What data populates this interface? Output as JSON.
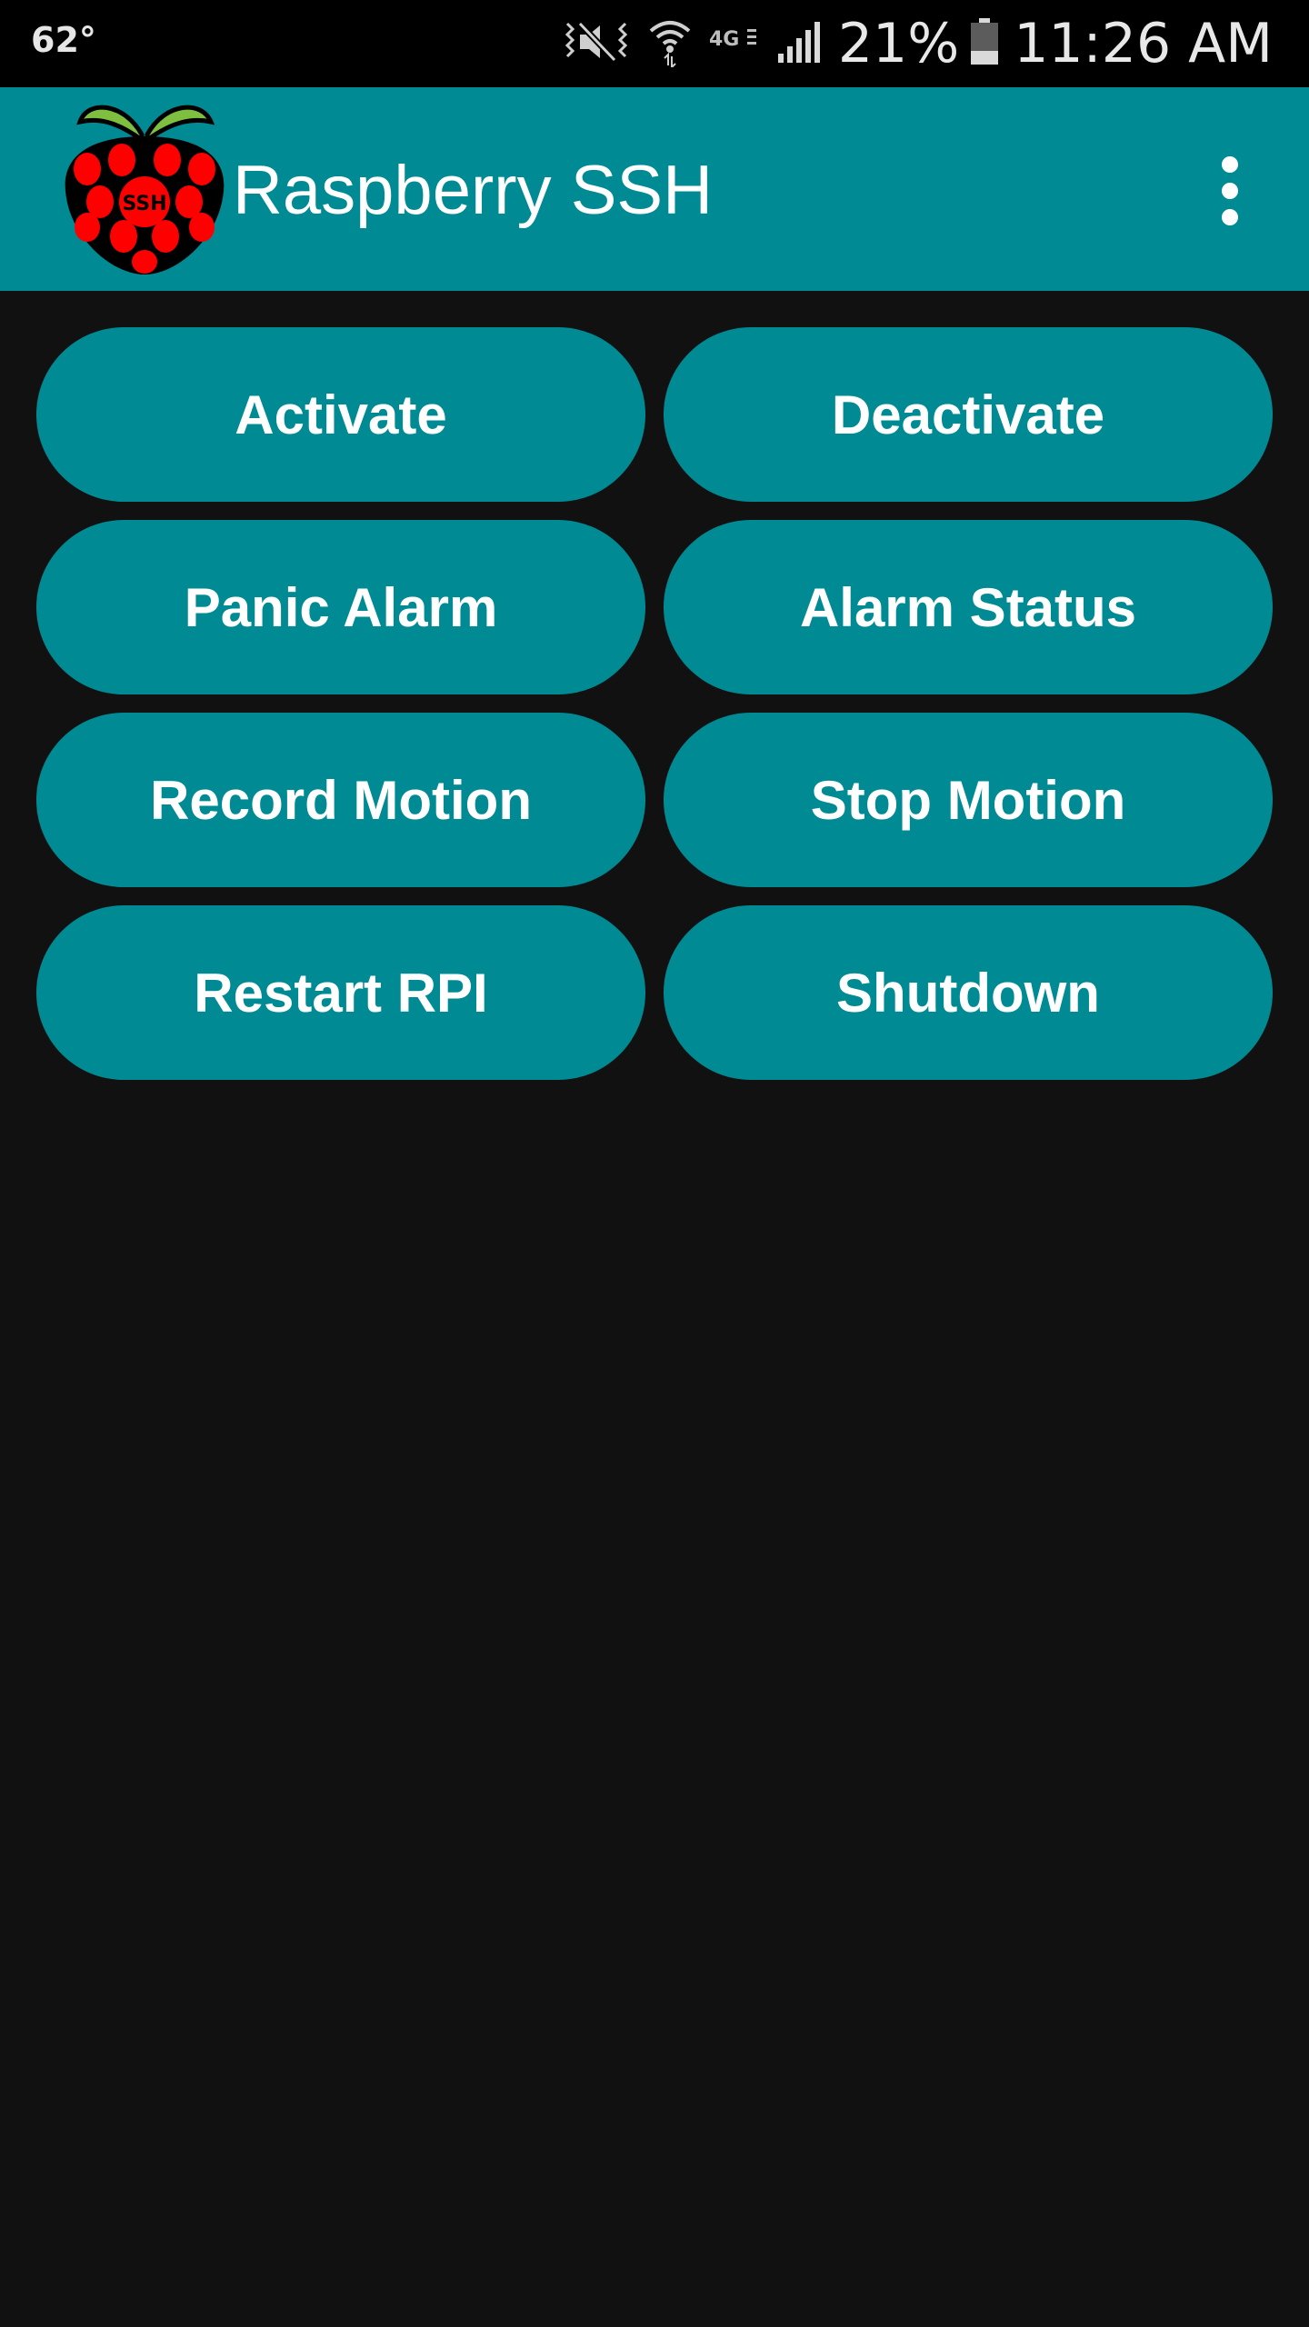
{
  "status_bar": {
    "temperature": "62°",
    "battery_percent": "21%",
    "time": "11:26 AM",
    "network_type": "4G",
    "icons": [
      "vibrate-mute-icon",
      "wifi-icon",
      "lte-icon",
      "signal-icon",
      "battery-icon"
    ]
  },
  "app_bar": {
    "title": "Raspberry SSH",
    "logo_text": "SSH",
    "menu_icon": "overflow-menu-icon"
  },
  "buttons": [
    {
      "label": "Activate"
    },
    {
      "label": "Deactivate"
    },
    {
      "label": "Panic Alarm"
    },
    {
      "label": "Alarm Status"
    },
    {
      "label": "Record Motion"
    },
    {
      "label": "Stop Motion"
    },
    {
      "label": "Restart RPI"
    },
    {
      "label": "Shutdown"
    }
  ],
  "colors": {
    "accent": "#008b94",
    "background": "#111111",
    "status_bar": "#000000",
    "logo_berry": "#ff0000",
    "logo_leaf": "#7fbf3f"
  }
}
